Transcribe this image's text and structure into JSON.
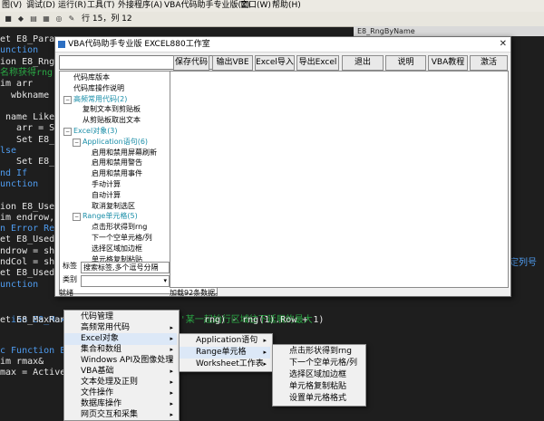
{
  "menubar": {
    "items": [
      "图(V)",
      "调试(D)",
      "运行(R)",
      "工具(T)",
      "外接程序(A)",
      "VBA代码助手专业版(Z)",
      "窗口(W)",
      "帮助(H)"
    ]
  },
  "toolbar": {
    "position": "行 15，列 12"
  },
  "range_box": "E8_RngByName",
  "code_lines": [
    {
      "text": "et E8_Paras",
      "cls": "id"
    },
    {
      "text": "unction",
      "cls": "kw"
    },
    {
      "text": "ion E8_RngBy",
      "cls": "id"
    },
    {
      "text": "名称获得rng,w",
      "cls": "cm"
    },
    {
      "text": "im arr",
      "cls": "id"
    },
    {
      "text": "  wbkname",
      "cls": "id"
    },
    {
      "text": "",
      "cls": "id"
    },
    {
      "text": " name Like",
      "cls": "id"
    },
    {
      "text": "   arr = Spl",
      "cls": "id"
    },
    {
      "text": "   Set E8_Rn",
      "cls": "id"
    },
    {
      "text": "lse",
      "cls": "kw"
    },
    {
      "text": "   Set E8_Rn",
      "cls": "id"
    },
    {
      "text": "nd If",
      "cls": "kw"
    },
    {
      "text": "unction",
      "cls": "kw"
    },
    {
      "text": "",
      "cls": "id"
    },
    {
      "text": "ion E8_UsedR",
      "cls": "id"
    },
    {
      "text": "im endrow, e",
      "cls": "id"
    },
    {
      "text": "n Error Resum",
      "cls": "kw"
    },
    {
      "text": "et E8_UsedRa",
      "cls": "id"
    },
    {
      "text": "ndrow = sht.",
      "cls": "id"
    },
    {
      "text": "ndCol = sht.",
      "cls": "id"
    },
    {
      "text": "et E8_UsedRa",
      "cls": "id"
    },
    {
      "text": "unction",
      "cls": "kw"
    }
  ],
  "code_right_fragment": "定列号",
  "bottom_code": {
    "line1_a": "ion E8_MaxRange(rng As Range)",
    "line1_b": "'某一起始行区域往下延展的最大",
    "line2_a": "et E8_MaxRange",
    "line2_b": "rng) - rng(1).Row + 1)",
    "line3": "",
    "line4": "c Function E8_",
    "line5": "im rmax&",
    "line6": "max = ActiveShe"
  },
  "dialog": {
    "title": "VBA代码助手专业版  EXCEL880工作室",
    "close_glyph": "✕",
    "buttons": [
      "保存代码",
      "输出VBE",
      "Excel导入",
      "导出Excel",
      "退出",
      "说明",
      "VBA教程",
      "激活"
    ],
    "tree": {
      "nodes": [
        {
          "label": "代码库版本",
          "indent": 0,
          "kind": "leaf"
        },
        {
          "label": "代码库操作说明",
          "indent": 0,
          "kind": "leaf"
        },
        {
          "label": "高频常用代码(2)",
          "indent": 0,
          "kind": "cat",
          "sign": "−"
        },
        {
          "label": "复制文本到剪贴板",
          "indent": 1,
          "kind": "leaf"
        },
        {
          "label": "从剪贴板取出文本",
          "indent": 1,
          "kind": "leaf"
        },
        {
          "label": "Excel对象(3)",
          "indent": 0,
          "kind": "cat",
          "sign": "−"
        },
        {
          "label": "Application语句(6)",
          "indent": 1,
          "kind": "cat",
          "sign": "−"
        },
        {
          "label": "启用和禁用屏幕刷新",
          "indent": 2,
          "kind": "leaf"
        },
        {
          "label": "启用和禁用警告",
          "indent": 2,
          "kind": "leaf"
        },
        {
          "label": "启用和禁用事件",
          "indent": 2,
          "kind": "leaf"
        },
        {
          "label": "手动计算",
          "indent": 2,
          "kind": "leaf"
        },
        {
          "label": "自动计算",
          "indent": 2,
          "kind": "leaf"
        },
        {
          "label": "取消复制选区",
          "indent": 2,
          "kind": "leaf"
        },
        {
          "label": "Range单元格(5)",
          "indent": 1,
          "kind": "cat",
          "sign": "−"
        },
        {
          "label": "点击形状得到rng",
          "indent": 2,
          "kind": "leaf"
        },
        {
          "label": "下一个空单元格/列",
          "indent": 2,
          "kind": "leaf"
        },
        {
          "label": "选择区域加边框",
          "indent": 2,
          "kind": "leaf"
        },
        {
          "label": "单元格复制粘贴",
          "indent": 2,
          "kind": "leaf"
        },
        {
          "label": "设置单元格格式",
          "indent": 2,
          "kind": "leaf"
        }
      ]
    },
    "label_tag": "标签",
    "tag_placeholder": "搜索标签,多个逗号分隔",
    "label_category": "类别",
    "status_left": "就绪",
    "status_right": "加载92条数据。"
  },
  "menu1": {
    "items": [
      {
        "label": "代码管理",
        "sub": false
      },
      {
        "label": "高频常用代码",
        "sub": true
      },
      {
        "label": "Excel对象",
        "sub": true,
        "hl": true
      },
      {
        "label": "集合和数组",
        "sub": true
      },
      {
        "label": "Windows API及图像处理",
        "sub": true
      },
      {
        "label": "VBA基础",
        "sub": true
      },
      {
        "label": "文本处理及正则",
        "sub": true
      },
      {
        "label": "文件操作",
        "sub": true
      },
      {
        "label": "数据库操作",
        "sub": true
      },
      {
        "label": "网页交互和采集",
        "sub": true
      }
    ]
  },
  "menu2": {
    "items": [
      {
        "label": "Application语句",
        "sub": true
      },
      {
        "label": "Range单元格",
        "sub": true,
        "hl": true
      },
      {
        "label": "Worksheet工作表",
        "sub": true
      }
    ]
  },
  "menu3": {
    "items": [
      {
        "label": "点击形状得到rng",
        "sub": false
      },
      {
        "label": "下一个空单元格/列",
        "sub": false
      },
      {
        "label": "选择区域加边框",
        "sub": false
      },
      {
        "label": "单元格复制粘贴",
        "sub": false
      },
      {
        "label": "设置单元格格式",
        "sub": false
      }
    ]
  },
  "chevron": "▸",
  "arrow_down": "▾"
}
